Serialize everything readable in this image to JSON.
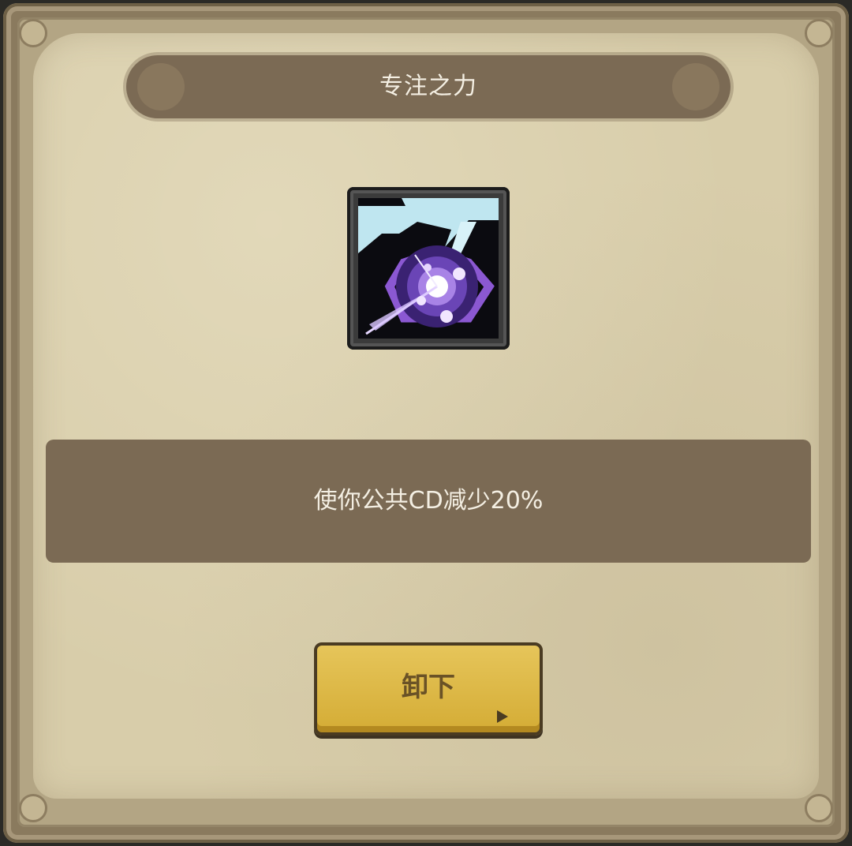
{
  "dialog": {
    "title": "专注之力",
    "skill_icon": "purple-clock-lightning-icon",
    "description": "使你公共CD减少20%",
    "unequip_label": "卸下"
  },
  "colors": {
    "parchment": "#d8cdaa",
    "banner": "#7b6a54",
    "button": "#e6c55a",
    "text_light": "#f4efe3"
  }
}
